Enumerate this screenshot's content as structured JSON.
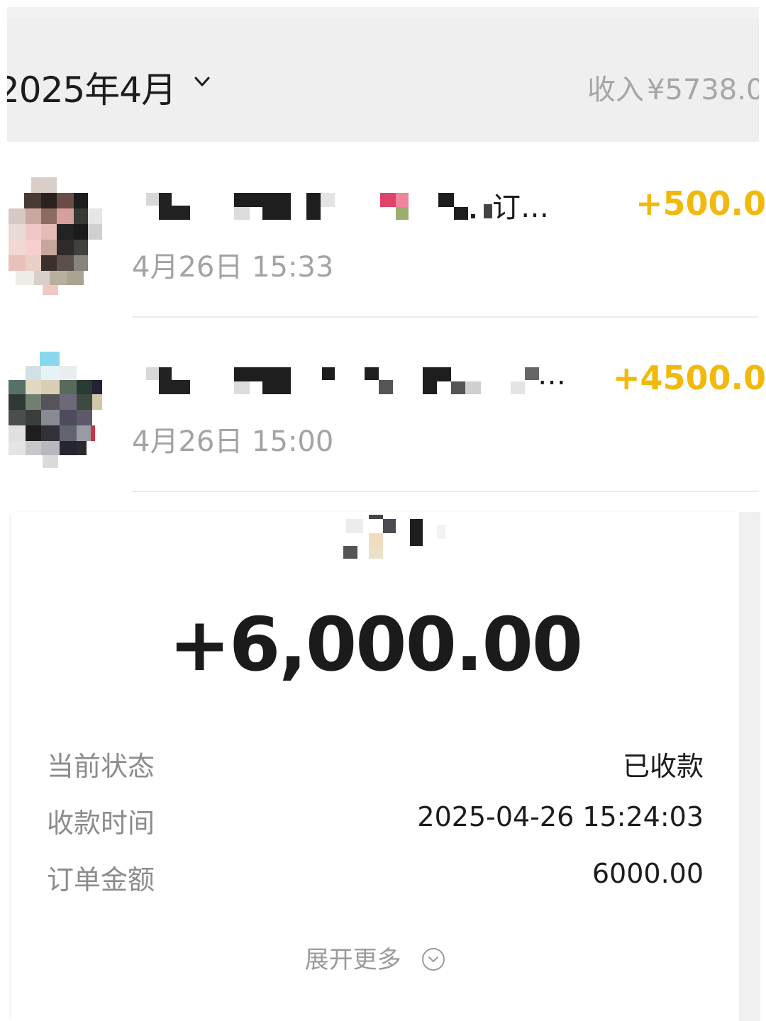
{
  "header": {
    "month": "2025年4月",
    "income_label": "收入",
    "income_value": "¥5738.0"
  },
  "transactions": [
    {
      "name_tail": "订…",
      "time": "4月26日 15:33",
      "amount": "+500.0",
      "amount_color": "#f2b90c"
    },
    {
      "name_tail": "…",
      "time": "4月26日 15:00",
      "amount": "+4500.0",
      "amount_color": "#f2b90c"
    }
  ],
  "detail": {
    "amount": "+6,000.00",
    "rows": [
      {
        "key": "当前状态",
        "value": "已收款"
      },
      {
        "key": "收款时间",
        "value": "2025-04-26 15:24:03"
      },
      {
        "key": "订单金额",
        "value": "6000.00"
      }
    ],
    "expand_label": "展开更多"
  },
  "icons": {
    "month_dropdown": "chevron-down-icon",
    "expand": "chevron-down-circle-icon"
  },
  "colors": {
    "income_amount": "#f2b90c",
    "header_bg": "#efefef"
  }
}
